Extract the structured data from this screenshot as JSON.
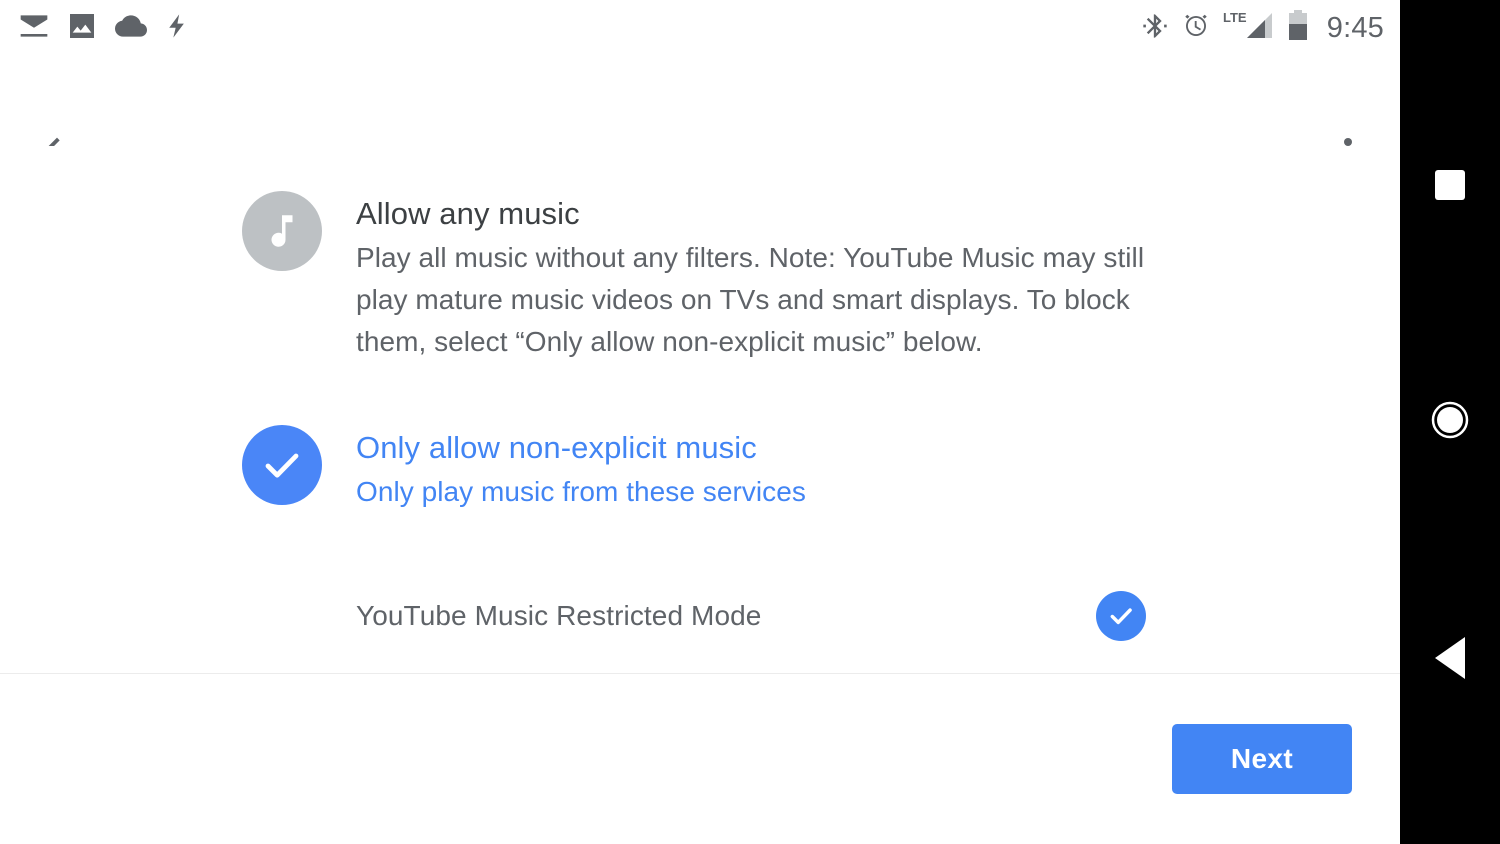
{
  "status_bar": {
    "time": "9:45",
    "left_icons": [
      "email-icon",
      "image-icon",
      "cloud-icon",
      "lightning-bolt-icon"
    ],
    "right_icons": [
      "bluetooth-icon",
      "alarm-clock-icon",
      "lte-signal-icon",
      "battery-icon"
    ],
    "network_label": "LTE"
  },
  "app_bar": {
    "back_icon": "back-arrow-icon",
    "overflow_icon": "more-vert-icon"
  },
  "content": {
    "options": [
      {
        "icon": "music-note-icon",
        "selected": false,
        "title": "Allow any music",
        "description": "Play all music without any filters. Note: YouTube Music may still play mature music videos on TVs and smart displays. To block them, select “Only allow non-explicit music” below."
      },
      {
        "icon": "check-circle-icon",
        "selected": true,
        "title": "Only allow non-explicit music",
        "description": "Only play music from these services"
      }
    ],
    "services": [
      {
        "label": "YouTube Music Restricted Mode",
        "checked": true,
        "check_icon": "check-circle-icon"
      }
    ]
  },
  "bottom_bar": {
    "next_label": "Next"
  },
  "nav_bar": {
    "recents_icon": "square-recents-icon",
    "home_icon": "circle-home-icon",
    "back_icon": "triangle-back-icon"
  },
  "colors": {
    "accent_blue": "#4285f4",
    "selected_blue": "#4a86f7",
    "icon_grey": "#bdc1c4",
    "text_primary": "#3c4043",
    "text_secondary": "#5f6368",
    "nav_background": "#000000",
    "page_background": "#ffffff"
  }
}
